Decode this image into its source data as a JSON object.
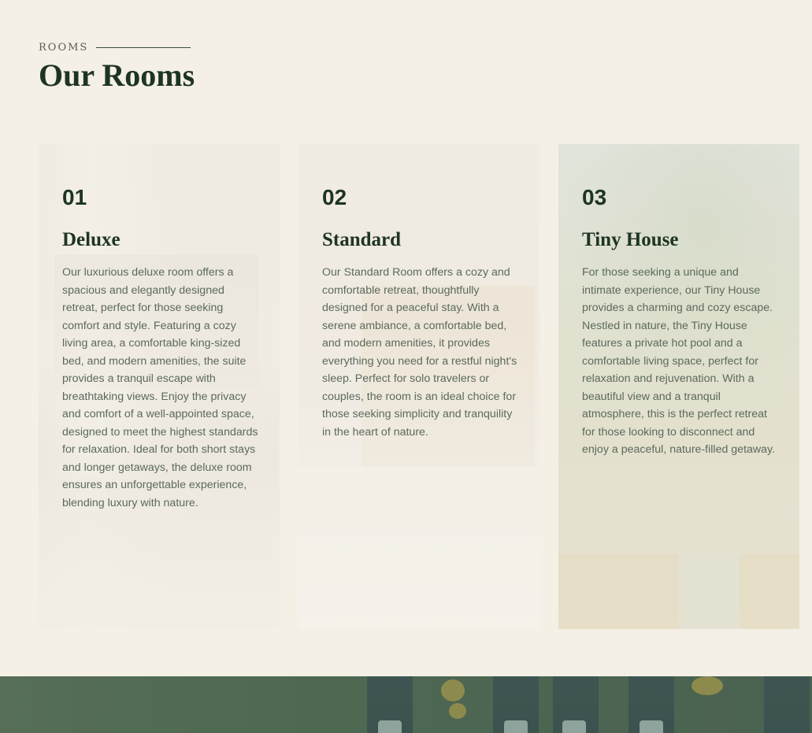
{
  "header": {
    "eyebrow": "ROOMS",
    "title": "Our Rooms"
  },
  "rooms": [
    {
      "number": "01",
      "name": "Deluxe",
      "description": "Our luxurious deluxe room offers a spacious and elegantly designed retreat, perfect for those seeking comfort and style. Featuring a cozy living area, a comfortable king-sized bed, and modern amenities, the suite provides a tranquil escape with breathtaking views. Enjoy the privacy and comfort of a well-appointed space, designed to meet the highest standards for relaxation. Ideal for both short stays and longer getaways, the deluxe room ensures an unforgettable experience, blending luxury with nature."
    },
    {
      "number": "02",
      "name": "Standard",
      "description": "Our Standard Room offers a cozy and comfortable retreat, thoughtfully designed for a peaceful stay. With a serene ambiance, a comfortable bed, and modern amenities, it provides everything you need for a restful night's sleep. Perfect for solo travelers or couples, the room is an ideal choice for those seeking simplicity and tranquility in the heart of nature."
    },
    {
      "number": "03",
      "name": "Tiny House",
      "description": "For those seeking a unique and intimate experience, our Tiny House provides a charming and cozy escape. Nestled in nature, the Tiny House features a private hot pool and a comfortable living space, perfect for relaxation and rejuvenation. With a beautiful view and a tranquil atmosphere, this is the perfect retreat for those looking to disconnect and enjoy a peaceful, nature-filled getaway."
    }
  ],
  "colors": {
    "background": "#f4f0e6",
    "heading": "#1e3423",
    "body_text": "#5b6a5c",
    "band": "#4c6550"
  }
}
